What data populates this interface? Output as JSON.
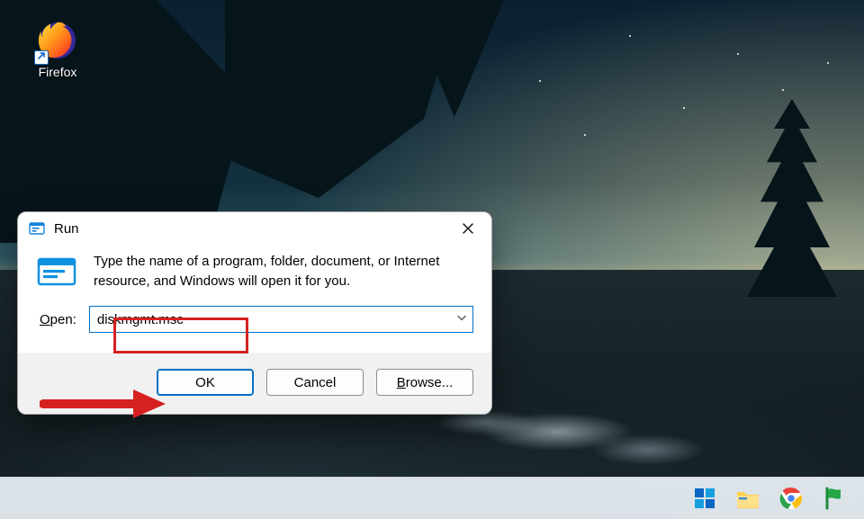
{
  "desktop": {
    "icons": {
      "firefox": {
        "label": "Firefox"
      }
    }
  },
  "run_dialog": {
    "title": "Run",
    "description": "Type the name of a program, folder, document, or Internet resource, and Windows will open it for you.",
    "open_label_pre": "O",
    "open_label_post": "pen:",
    "open_value": "diskmgmt.msc",
    "buttons": {
      "ok": "OK",
      "cancel": "Cancel",
      "browse_pre": "B",
      "browse_post": "rowse..."
    }
  },
  "annotations": {
    "highlight_target": "open-input",
    "arrow_target": "ok-button",
    "color": "#d62121"
  }
}
